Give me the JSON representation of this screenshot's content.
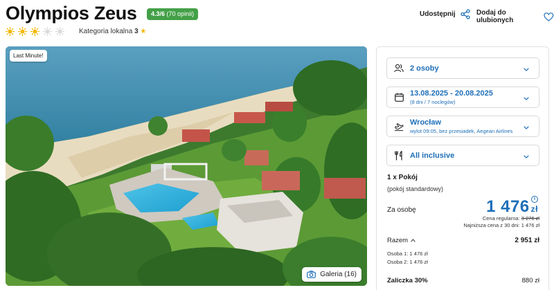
{
  "hotel": {
    "name": "Olympios Zeus",
    "rating_score": "4.3/6",
    "rating_count": "(70 opinii)",
    "suns_total": 5,
    "suns_filled": 3,
    "category_label": "Kategoria lokalna",
    "category_value": "3"
  },
  "actions": {
    "share_label": "Udostępnij",
    "favorite_label": "Dodaj do ulubionych"
  },
  "hero": {
    "badge": "Last Minute!",
    "gallery_label": "Galeria (16)"
  },
  "booking": {
    "persons": "2 osoby",
    "dates": "13.08.2025 - 20.08.2025",
    "dates_sub": "(8 dni / 7 noclegów)",
    "departure_city": "Wrocław",
    "departure_sub": "wylot 09:05, bez przesiadek, Aegean Airlines",
    "board": "All inclusive"
  },
  "room": {
    "title": "1 x Pokój",
    "subtitle": "(pokój standardowy)"
  },
  "pricing": {
    "per_person_label": "Za osobę",
    "price": "1 476",
    "currency": "zł",
    "regular_label": "Cena regularna:",
    "regular_price": "3 276 zł",
    "lowest_label": "Najniższa cena z 30 dni: 1 476 zł",
    "total_label": "Razem",
    "total_value": "2 951 zł",
    "person1": "Osoba 1: 1 476 zł",
    "person2": "Osoba 2: 1 476 zł",
    "deposit_label": "Zaliczka 30%",
    "deposit_value": "880 zł"
  },
  "colors": {
    "accent": "#1e6fb8",
    "rating_badge": "#43a047",
    "sun_filled": "#f5b800",
    "sun_empty": "#d9d9d9"
  }
}
